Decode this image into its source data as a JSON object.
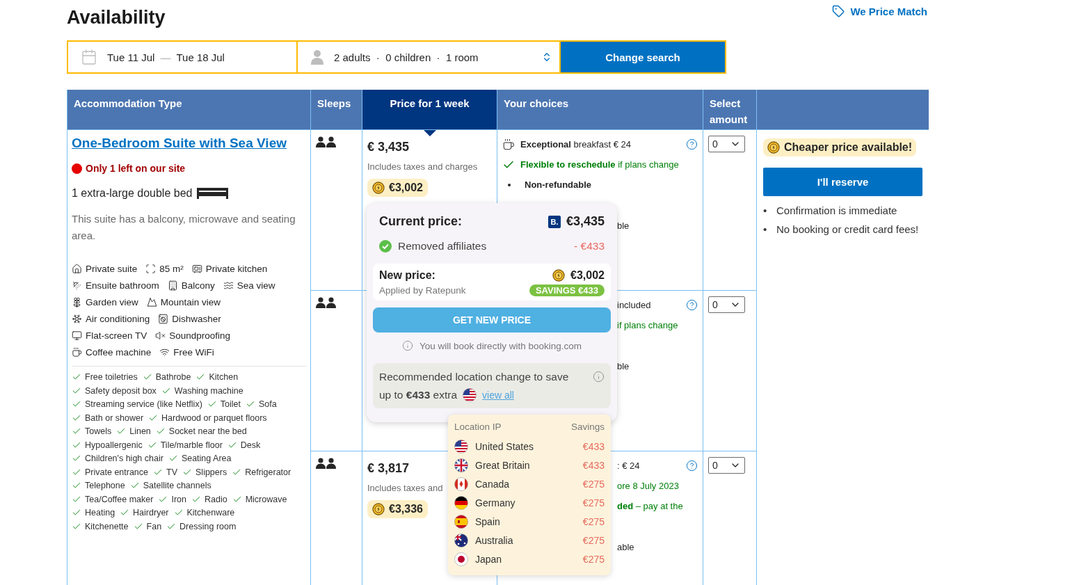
{
  "title": "Availability",
  "price_match": "We Price Match",
  "search": {
    "checkin": "Tue 11 Jul",
    "separator": "—",
    "checkout": "Tue 18 Jul",
    "guests": "2 adults  ·  0 children  ·  1 room",
    "button": "Change search"
  },
  "columns": [
    {
      "label": "Accommodation Type",
      "selected": false
    },
    {
      "label": "Sleeps",
      "selected": false
    },
    {
      "label": "Price for 1 week",
      "selected": true
    },
    {
      "label": "Your choices",
      "selected": false
    },
    {
      "label": "Select amount",
      "selected": false
    }
  ],
  "room": {
    "name": "One-Bedroom Suite with Sea View",
    "scarcity": "Only 1 left on our site",
    "bed": "1 extra-large double bed",
    "description": "This suite has a balcony, microwave and seating area.",
    "facilities": [
      [
        "Private suite",
        "85 m²",
        "Private kitchen"
      ],
      [
        "Ensuite bathroom",
        "Balcony",
        "Sea view"
      ],
      [
        "Garden view",
        "Mountain view"
      ],
      [
        "Air conditioning",
        "Dishwasher"
      ],
      [
        "Flat-screen TV",
        "Soundproofing"
      ],
      [
        "Coffee machine",
        "Free WiFi"
      ]
    ],
    "amenities": [
      [
        "Free toiletries",
        "Bathrobe",
        "Kitchen"
      ],
      [
        "Safety deposit box",
        "Washing machine"
      ],
      [
        "Streaming service (like Netflix)",
        "Toilet",
        "Sofa"
      ],
      [
        "Bath or shower",
        "Hardwood or parquet floors"
      ],
      [
        "Towels",
        "Linen",
        "Socket near the bed"
      ],
      [
        "Hypoallergenic",
        "Tile/marble floor",
        "Desk"
      ],
      [
        "Children's high chair",
        "Seating Area"
      ],
      [
        "Private entrance",
        "TV",
        "Slippers",
        "Refrigerator"
      ],
      [
        "Telephone",
        "Satellite channels"
      ],
      [
        "Tea/Coffee maker",
        "Iron",
        "Radio",
        "Microwave"
      ],
      [
        "Heating",
        "Hairdryer",
        "Kitchenware"
      ],
      [
        "Kitchenette",
        "Fan",
        "Dressing room"
      ]
    ]
  },
  "rows": [
    {
      "price": "€ 3,435",
      "price_note": "Includes taxes and charges",
      "deal": "€3,002",
      "select": "0",
      "choices": [
        {
          "kind": "meal",
          "text": "**Exceptional** breakfast € 24",
          "help": true
        },
        {
          "kind": "flexible",
          "text": "**Flexible to reschedule** if plans change",
          "help": false
        },
        {
          "kind": "bullet",
          "text": "Non-refundable",
          "help": false
        },
        {
          "kind": "cut_gap",
          "text": "ble",
          "help": false
        }
      ]
    },
    {
      "select": "0",
      "choices": [
        {
          "kind": "cut",
          "text": "included",
          "help": true
        },
        {
          "kind": "cut_green",
          "text": "if plans change",
          "help": false
        },
        {
          "kind": "cut_gap",
          "text": "ble",
          "help": false
        }
      ]
    },
    {
      "price": "€ 3,817",
      "price_note": "Includes taxes and",
      "deal": "€3,336",
      "select": "0",
      "choices": [
        {
          "kind": "cut",
          "text": ": € 24",
          "help": true
        },
        {
          "kind": "cut_green",
          "text": "ore 8 July 2023",
          "help": false
        },
        {
          "kind": "cut_green",
          "text": "**ded** – pay at the",
          "help": false
        },
        {
          "kind": "cut_gap",
          "text": "able",
          "help": false
        }
      ]
    }
  ],
  "offer": {
    "cheaper": "Cheaper price available!",
    "reserve": "I'll reserve",
    "marker": "•",
    "benefits": [
      "Confirmation is immediate",
      "No booking or credit card fees!"
    ]
  },
  "popup": {
    "current_label": "Current price:",
    "provider_badge": "B.",
    "current_price": "€3,435",
    "removed_label": "Removed affiliates",
    "removed_amount": "- €433",
    "new_label": "New price:",
    "new_price": "€3,002",
    "applied_by": "Applied by Ratepunk",
    "savings": "SAVINGS €433",
    "button": "GET NEW PRICE",
    "note": "You will book directly with booking.com",
    "recommend": [
      "Recommended location change to save",
      "up to **€433** extra"
    ],
    "view_all": "view all"
  },
  "locations": {
    "header_location": "Location IP",
    "header_savings": "Savings",
    "items": [
      {
        "country": "United States",
        "saving": "€433"
      },
      {
        "country": "Great Britain",
        "saving": "€433"
      },
      {
        "country": "Canada",
        "saving": "€275"
      },
      {
        "country": "Germany",
        "saving": "€275"
      },
      {
        "country": "Spain",
        "saving": "€275"
      },
      {
        "country": "Australia",
        "saving": "€275"
      },
      {
        "country": "Japan",
        "saving": "€275"
      }
    ]
  }
}
